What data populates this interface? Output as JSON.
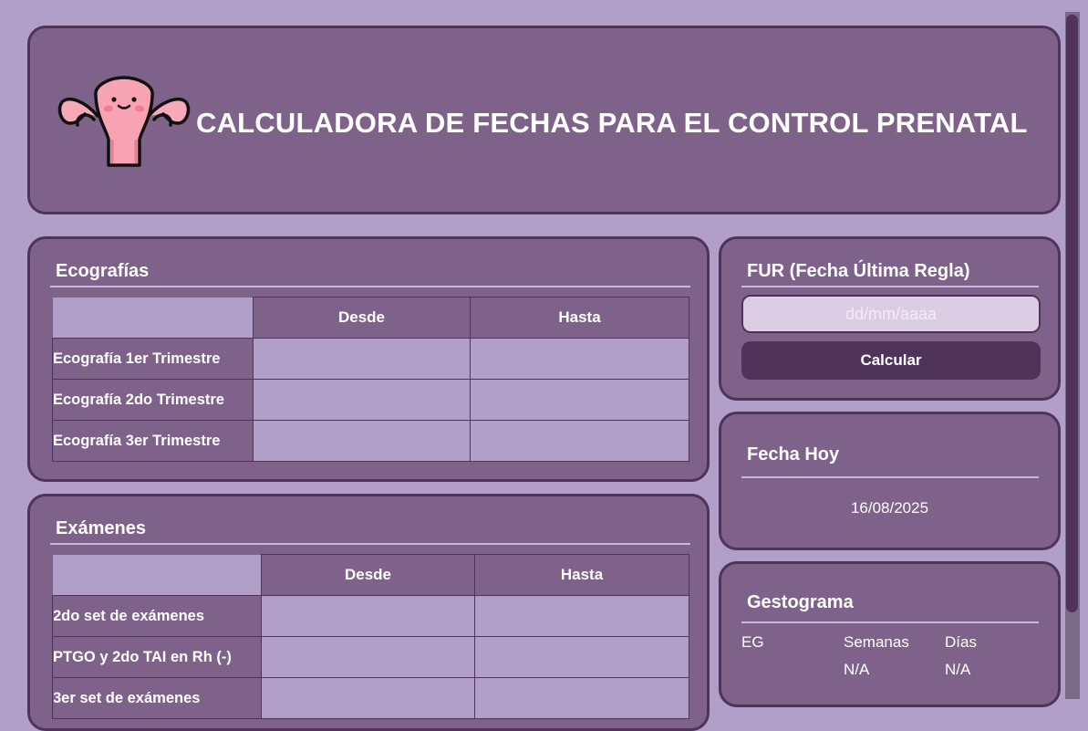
{
  "header": {
    "title": "CALCULADORA DE FECHAS PARA EL CONTROL PRENATAL",
    "icon": "uterus-icon"
  },
  "ecografias": {
    "title": "Ecografías",
    "columns": [
      "Desde",
      "Hasta"
    ],
    "rows": [
      {
        "label": "Ecografía 1er Trimestre",
        "desde": "",
        "hasta": ""
      },
      {
        "label": "Ecografía 2do Trimestre",
        "desde": "",
        "hasta": ""
      },
      {
        "label": "Ecografía 3er Trimestre",
        "desde": "",
        "hasta": ""
      }
    ]
  },
  "examenes": {
    "title": "Exámenes",
    "columns": [
      "Desde",
      "Hasta"
    ],
    "rows": [
      {
        "label": "2do set de exámenes",
        "desde": "",
        "hasta": ""
      },
      {
        "label": "PTGO y 2do TAI en Rh (-)",
        "desde": "",
        "hasta": ""
      },
      {
        "label": "3er set de exámenes",
        "desde": "",
        "hasta": ""
      }
    ]
  },
  "fur": {
    "title": "FUR (Fecha Última Regla)",
    "input_value": "",
    "input_placeholder": "dd/mm/aaaa",
    "button_label": "Calcular"
  },
  "today": {
    "title": "Fecha Hoy",
    "value": "16/08/2025"
  },
  "gestograma": {
    "title": "Gestograma",
    "eg_label": "EG",
    "weeks_label": "Semanas",
    "days_label": "Días",
    "weeks_value": "N/A",
    "days_value": "N/A"
  },
  "colors": {
    "background": "#b19fca",
    "card": "#7f6289",
    "border": "#4f3359",
    "button": "#4f3359",
    "input": "#dccde4"
  }
}
